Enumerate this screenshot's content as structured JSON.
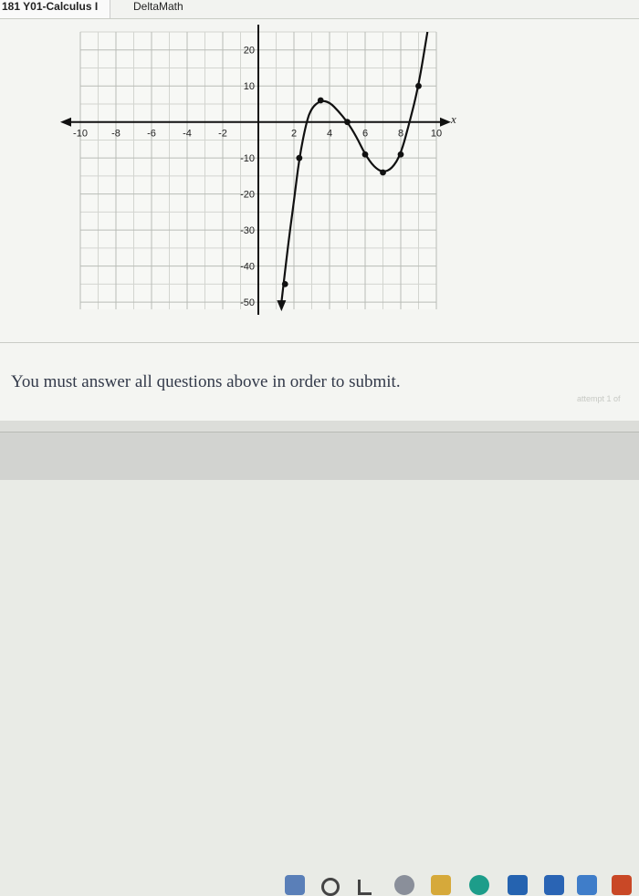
{
  "browser": {
    "tabs": [
      {
        "label": "181 Y01-Calculus I"
      },
      {
        "label": "DeltaMath"
      }
    ]
  },
  "graph": {
    "axis_label_x": "x"
  },
  "message": {
    "text": "You must answer all questions above in order to submit.",
    "attempt": "attempt 1 of"
  },
  "taskbar": {
    "icons": [
      "windows-start-icon",
      "search-icon",
      "task-view-icon",
      "file-explorer-icon",
      "folder-icon",
      "edge-browser-icon",
      "store-icon",
      "word-icon",
      "outlook-icon",
      "office-icon"
    ]
  },
  "chart_data": {
    "type": "line",
    "xlim": [
      -10,
      10
    ],
    "ylim": [
      -50,
      20
    ],
    "grid": true,
    "x_ticks": [
      -10,
      -8,
      -6,
      -4,
      -2,
      2,
      4,
      6,
      8,
      10
    ],
    "y_ticks": [
      20,
      10,
      -10,
      -20,
      -30,
      -40,
      -50
    ],
    "series": [
      {
        "curve": [
          {
            "x": 1.3,
            "y": -50
          },
          {
            "x": 1.7,
            "y": -33
          },
          {
            "x": 2,
            "y": -22
          },
          {
            "x": 2.3,
            "y": -10
          },
          {
            "x": 2.7,
            "y": 0
          },
          {
            "x": 3,
            "y": 4
          },
          {
            "x": 3.5,
            "y": 6
          },
          {
            "x": 4,
            "y": 5.5
          },
          {
            "x": 4.5,
            "y": 3
          },
          {
            "x": 5,
            "y": 0
          },
          {
            "x": 5.5,
            "y": -4
          },
          {
            "x": 6,
            "y": -9
          },
          {
            "x": 6.5,
            "y": -12.5
          },
          {
            "x": 7,
            "y": -14
          },
          {
            "x": 7.5,
            "y": -13
          },
          {
            "x": 8,
            "y": -9
          },
          {
            "x": 8.5,
            "y": 0
          },
          {
            "x": 9,
            "y": 10
          },
          {
            "x": 9.5,
            "y": 25
          }
        ],
        "points": [
          {
            "x": 1.5,
            "y": -45
          },
          {
            "x": 2.3,
            "y": -10
          },
          {
            "x": 3.5,
            "y": 6
          },
          {
            "x": 5,
            "y": 0
          },
          {
            "x": 6,
            "y": -9
          },
          {
            "x": 7,
            "y": -14
          },
          {
            "x": 8,
            "y": -9
          },
          {
            "x": 9,
            "y": 10
          }
        ]
      }
    ]
  }
}
